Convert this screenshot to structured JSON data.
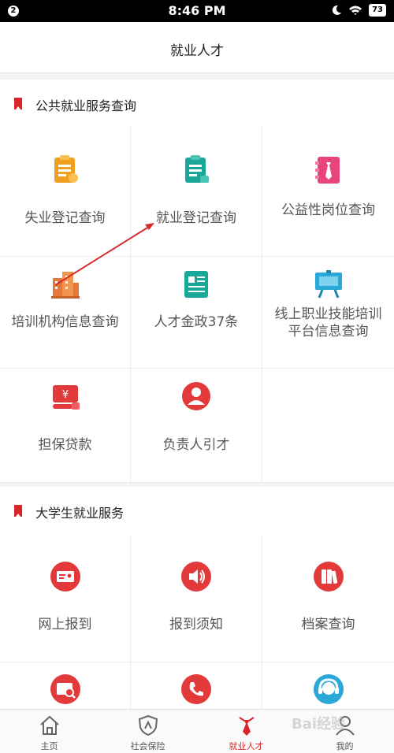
{
  "status_bar": {
    "notification_count": "2",
    "time": "8:46 PM",
    "battery": "73"
  },
  "header": {
    "title": "就业人才"
  },
  "sections": [
    {
      "title": "公共就业服务查询",
      "items": [
        {
          "label": "失业登记查询",
          "icon": "clipboard-icon"
        },
        {
          "label": "就业登记查询",
          "icon": "clipboard-lock-icon"
        },
        {
          "label": "公益性岗位查询",
          "icon": "tie-card-icon"
        },
        {
          "label": "培训机构信息查询",
          "icon": "buildings-icon"
        },
        {
          "label": "人才金政37条",
          "icon": "document-icon"
        },
        {
          "label": "线上职业技能培训平台信息查询",
          "icon": "presentation-board-icon"
        },
        {
          "label": "担保贷款",
          "icon": "yuan-loan-icon"
        },
        {
          "label": "负责人引才",
          "icon": "person-circle-icon"
        }
      ]
    },
    {
      "title": "大学生就业服务",
      "items": [
        {
          "label": "网上报到",
          "icon": "id-card-icon"
        },
        {
          "label": "报到须知",
          "icon": "speaker-icon"
        },
        {
          "label": "档案查询",
          "icon": "file-folders-icon"
        },
        {
          "label": "",
          "icon": "search-card-icon"
        },
        {
          "label": "",
          "icon": "phone-icon"
        },
        {
          "label": "",
          "icon": "headset-icon"
        }
      ]
    }
  ],
  "tabs": [
    {
      "label": "主页",
      "icon": "home-icon"
    },
    {
      "label": "社会保险",
      "icon": "shield-person-icon"
    },
    {
      "label": "就业人才",
      "icon": "red-tie-icon",
      "active": true
    },
    {
      "label": "我的",
      "icon": "person-icon"
    }
  ],
  "watermark": "Bai经验",
  "colors": {
    "accent": "#d9262a",
    "orange": "#f0a020",
    "teal": "#19a79a",
    "pink": "#e8457a",
    "cyan": "#2aa8d8"
  }
}
